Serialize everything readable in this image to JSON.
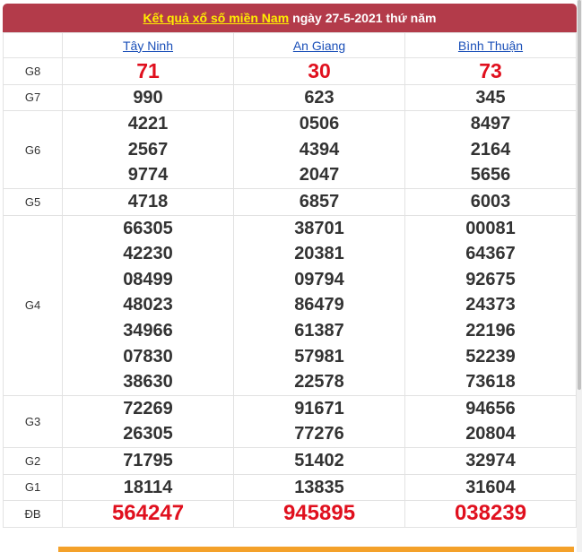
{
  "title": {
    "link": "Kết quả xổ số miền Nam",
    "suffix": "ngày 27-5-2021 thứ năm"
  },
  "provinces": [
    "Tây Ninh",
    "An Giang",
    "Bình Thuận"
  ],
  "rows": [
    {
      "label": "G8",
      "values": [
        [
          "71"
        ],
        [
          "30"
        ],
        [
          "73"
        ]
      ],
      "style": "red"
    },
    {
      "label": "G7",
      "values": [
        [
          "990"
        ],
        [
          "623"
        ],
        [
          "345"
        ]
      ]
    },
    {
      "label": "G6",
      "values": [
        [
          "4221",
          "2567",
          "9774"
        ],
        [
          "0506",
          "4394",
          "2047"
        ],
        [
          "8497",
          "2164",
          "5656"
        ]
      ]
    },
    {
      "label": "G5",
      "values": [
        [
          "4718"
        ],
        [
          "6857"
        ],
        [
          "6003"
        ]
      ]
    },
    {
      "label": "G4",
      "values": [
        [
          "66305",
          "42230",
          "08499",
          "48023",
          "34966",
          "07830",
          "38630"
        ],
        [
          "38701",
          "20381",
          "09794",
          "86479",
          "61387",
          "57981",
          "22578"
        ],
        [
          "00081",
          "64367",
          "92675",
          "24373",
          "22196",
          "52239",
          "73618"
        ]
      ]
    },
    {
      "label": "G3",
      "values": [
        [
          "72269",
          "26305"
        ],
        [
          "91671",
          "77276"
        ],
        [
          "94656",
          "20804"
        ]
      ]
    },
    {
      "label": "G2",
      "values": [
        [
          "71795"
        ],
        [
          "51402"
        ],
        [
          "32974"
        ]
      ]
    },
    {
      "label": "G1",
      "values": [
        [
          "18114"
        ],
        [
          "13835"
        ],
        [
          "31604"
        ]
      ]
    },
    {
      "label": "ĐB",
      "values": [
        [
          "564247"
        ],
        [
          "945895"
        ],
        [
          "038239"
        ]
      ],
      "style": "big"
    }
  ]
}
